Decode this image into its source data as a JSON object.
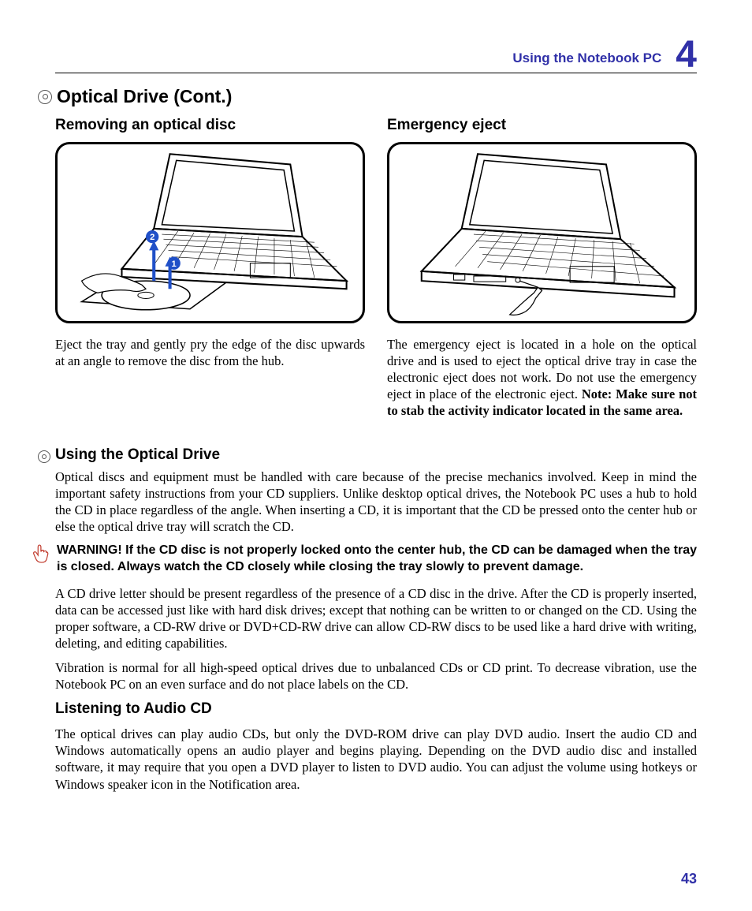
{
  "header": {
    "section_title": "Using the Notebook PC",
    "chapter_number": "4"
  },
  "h1": "Optical Drive (Cont.)",
  "columns": {
    "left": {
      "heading": "Removing an optical disc",
      "text": "Eject the tray and gently pry the edge of the disc upwards at an angle to remove the disc from the hub."
    },
    "right": {
      "heading": "Emergency eject",
      "text_1": "The emergency eject is located in a hole on the optical drive and is used to eject the optical drive tray in case the electronic eject does not work. Do not use the emergency eject in place of the electronic eject. ",
      "note_bold": "Note: Make sure not to stab the activity indicator located in the same area."
    }
  },
  "using": {
    "heading": "Using the Optical Drive",
    "p1": "Optical discs and equipment must be handled with care because of the precise mechanics involved. Keep in mind the important safety instructions from your CD suppliers. Unlike desktop optical drives, the Notebook PC uses a hub to hold the CD in place regardless of the angle. When inserting a CD, it is important that the CD be pressed onto the center hub or else the optical drive tray will scratch the CD."
  },
  "warning": {
    "text": "WARNING!  If the CD disc is not properly locked onto the center hub, the CD can be damaged when the tray is closed. Always watch the CD closely while closing the tray slowly to prevent damage."
  },
  "p_after_warning_1": "A CD drive letter should be present regardless of the presence of a CD disc in the drive. After the CD is properly inserted, data can be accessed just like with hard disk drives; except that nothing can be written to or changed on the CD. Using the proper software, a CD-RW drive or DVD+CD-RW drive can allow CD-RW discs to be used like a hard drive with writing, deleting, and editing capabilities.",
  "p_after_warning_2": "Vibration is normal for all high-speed optical drives due to unbalanced CDs or CD print. To decrease vibration, use the Notebook PC on an even surface and do not place labels on the CD.",
  "listening": {
    "heading": "Listening to Audio CD",
    "p": "The optical drives can play audio CDs, but only the DVD-ROM drive can play DVD audio. Insert the audio CD and Windows automatically opens an audio player and begins playing. Depending on the DVD audio disc and installed software, it may require that you open a DVD player to listen to DVD audio. You can adjust the volume using hotkeys or Windows speaker icon in the Notification area."
  },
  "page_number": "43",
  "callouts": {
    "c1": "1",
    "c2": "2"
  }
}
